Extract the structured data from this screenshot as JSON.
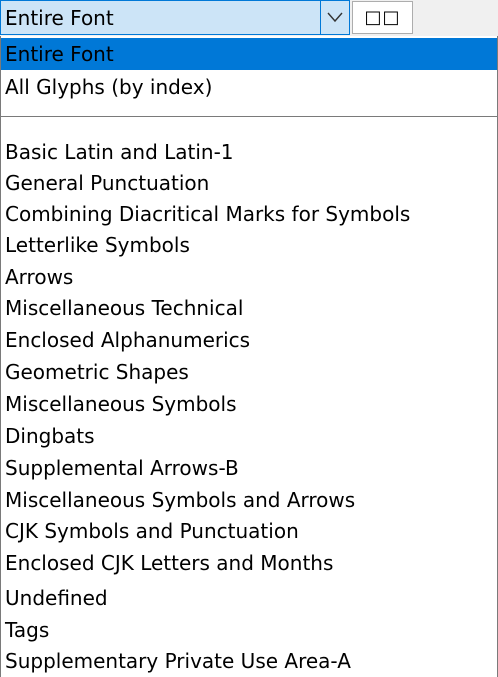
{
  "combo": {
    "value": "Entire Font",
    "arrow_icon": "chevron-down-icon"
  },
  "glyph_box": {
    "text": "□□"
  },
  "colors": {
    "selection": "#0078d7",
    "combo_background": "#cce4f7"
  },
  "dropdown": {
    "top_items": [
      {
        "label": "Entire Font",
        "selected": true
      },
      {
        "label": "All Glyphs (by index)",
        "selected": false
      }
    ],
    "range_items": [
      {
        "label": "Basic Latin and Latin-1"
      },
      {
        "label": "General Punctuation"
      },
      {
        "label": "Combining Diacritical Marks for Symbols"
      },
      {
        "label": "Letterlike Symbols"
      },
      {
        "label": "Arrows"
      },
      {
        "label": "Miscellaneous Technical"
      },
      {
        "label": "Enclosed Alphanumerics"
      },
      {
        "label": "Geometric Shapes"
      },
      {
        "label": "Miscellaneous Symbols"
      },
      {
        "label": "Dingbats"
      },
      {
        "label": "Supplemental Arrows-B"
      },
      {
        "label": "Miscellaneous Symbols and Arrows"
      },
      {
        "label": "CJK Symbols and Punctuation"
      },
      {
        "label": "Enclosed CJK Letters and Months"
      },
      {
        "label": "Undefined"
      },
      {
        "label": "Tags"
      },
      {
        "label": "Supplementary Private Use Area-A"
      }
    ]
  }
}
